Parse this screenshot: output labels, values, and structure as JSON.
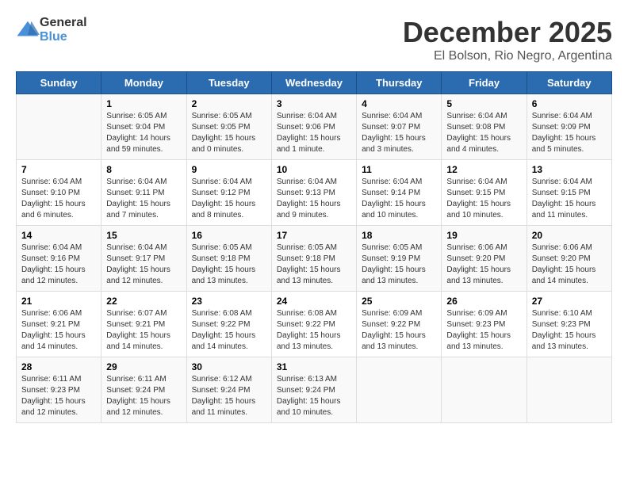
{
  "header": {
    "logo_general": "General",
    "logo_blue": "Blue",
    "title": "December 2025",
    "subtitle": "El Bolson, Rio Negro, Argentina"
  },
  "weekdays": [
    "Sunday",
    "Monday",
    "Tuesday",
    "Wednesday",
    "Thursday",
    "Friday",
    "Saturday"
  ],
  "weeks": [
    [
      {
        "day": "",
        "info": ""
      },
      {
        "day": "1",
        "info": "Sunrise: 6:05 AM\nSunset: 9:04 PM\nDaylight: 14 hours\nand 59 minutes."
      },
      {
        "day": "2",
        "info": "Sunrise: 6:05 AM\nSunset: 9:05 PM\nDaylight: 15 hours\nand 0 minutes."
      },
      {
        "day": "3",
        "info": "Sunrise: 6:04 AM\nSunset: 9:06 PM\nDaylight: 15 hours\nand 1 minute."
      },
      {
        "day": "4",
        "info": "Sunrise: 6:04 AM\nSunset: 9:07 PM\nDaylight: 15 hours\nand 3 minutes."
      },
      {
        "day": "5",
        "info": "Sunrise: 6:04 AM\nSunset: 9:08 PM\nDaylight: 15 hours\nand 4 minutes."
      },
      {
        "day": "6",
        "info": "Sunrise: 6:04 AM\nSunset: 9:09 PM\nDaylight: 15 hours\nand 5 minutes."
      }
    ],
    [
      {
        "day": "7",
        "info": "Sunrise: 6:04 AM\nSunset: 9:10 PM\nDaylight: 15 hours\nand 6 minutes."
      },
      {
        "day": "8",
        "info": "Sunrise: 6:04 AM\nSunset: 9:11 PM\nDaylight: 15 hours\nand 7 minutes."
      },
      {
        "day": "9",
        "info": "Sunrise: 6:04 AM\nSunset: 9:12 PM\nDaylight: 15 hours\nand 8 minutes."
      },
      {
        "day": "10",
        "info": "Sunrise: 6:04 AM\nSunset: 9:13 PM\nDaylight: 15 hours\nand 9 minutes."
      },
      {
        "day": "11",
        "info": "Sunrise: 6:04 AM\nSunset: 9:14 PM\nDaylight: 15 hours\nand 10 minutes."
      },
      {
        "day": "12",
        "info": "Sunrise: 6:04 AM\nSunset: 9:15 PM\nDaylight: 15 hours\nand 10 minutes."
      },
      {
        "day": "13",
        "info": "Sunrise: 6:04 AM\nSunset: 9:15 PM\nDaylight: 15 hours\nand 11 minutes."
      }
    ],
    [
      {
        "day": "14",
        "info": "Sunrise: 6:04 AM\nSunset: 9:16 PM\nDaylight: 15 hours\nand 12 minutes."
      },
      {
        "day": "15",
        "info": "Sunrise: 6:04 AM\nSunset: 9:17 PM\nDaylight: 15 hours\nand 12 minutes."
      },
      {
        "day": "16",
        "info": "Sunrise: 6:05 AM\nSunset: 9:18 PM\nDaylight: 15 hours\nand 13 minutes."
      },
      {
        "day": "17",
        "info": "Sunrise: 6:05 AM\nSunset: 9:18 PM\nDaylight: 15 hours\nand 13 minutes."
      },
      {
        "day": "18",
        "info": "Sunrise: 6:05 AM\nSunset: 9:19 PM\nDaylight: 15 hours\nand 13 minutes."
      },
      {
        "day": "19",
        "info": "Sunrise: 6:06 AM\nSunset: 9:20 PM\nDaylight: 15 hours\nand 13 minutes."
      },
      {
        "day": "20",
        "info": "Sunrise: 6:06 AM\nSunset: 9:20 PM\nDaylight: 15 hours\nand 14 minutes."
      }
    ],
    [
      {
        "day": "21",
        "info": "Sunrise: 6:06 AM\nSunset: 9:21 PM\nDaylight: 15 hours\nand 14 minutes."
      },
      {
        "day": "22",
        "info": "Sunrise: 6:07 AM\nSunset: 9:21 PM\nDaylight: 15 hours\nand 14 minutes."
      },
      {
        "day": "23",
        "info": "Sunrise: 6:08 AM\nSunset: 9:22 PM\nDaylight: 15 hours\nand 14 minutes."
      },
      {
        "day": "24",
        "info": "Sunrise: 6:08 AM\nSunset: 9:22 PM\nDaylight: 15 hours\nand 13 minutes."
      },
      {
        "day": "25",
        "info": "Sunrise: 6:09 AM\nSunset: 9:22 PM\nDaylight: 15 hours\nand 13 minutes."
      },
      {
        "day": "26",
        "info": "Sunrise: 6:09 AM\nSunset: 9:23 PM\nDaylight: 15 hours\nand 13 minutes."
      },
      {
        "day": "27",
        "info": "Sunrise: 6:10 AM\nSunset: 9:23 PM\nDaylight: 15 hours\nand 13 minutes."
      }
    ],
    [
      {
        "day": "28",
        "info": "Sunrise: 6:11 AM\nSunset: 9:23 PM\nDaylight: 15 hours\nand 12 minutes."
      },
      {
        "day": "29",
        "info": "Sunrise: 6:11 AM\nSunset: 9:24 PM\nDaylight: 15 hours\nand 12 minutes."
      },
      {
        "day": "30",
        "info": "Sunrise: 6:12 AM\nSunset: 9:24 PM\nDaylight: 15 hours\nand 11 minutes."
      },
      {
        "day": "31",
        "info": "Sunrise: 6:13 AM\nSunset: 9:24 PM\nDaylight: 15 hours\nand 10 minutes."
      },
      {
        "day": "",
        "info": ""
      },
      {
        "day": "",
        "info": ""
      },
      {
        "day": "",
        "info": ""
      }
    ]
  ]
}
